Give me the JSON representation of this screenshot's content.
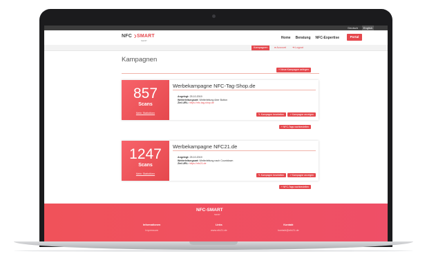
{
  "language": {
    "de": "Deutsch",
    "en": "English"
  },
  "header": {
    "logo_nfc": "NFC",
    "logo_smart": "SMART",
    "logo_sub": "SHOP",
    "nav": [
      "Home",
      "Beratung",
      "NFC-Expertise"
    ],
    "portal_label": "Portal"
  },
  "subnav": {
    "active": "Kampagnen",
    "account": "Account",
    "logout": "Logout"
  },
  "page": {
    "title": "Kampagnen",
    "new_campaign": "+ Neue Kampagne anlegen"
  },
  "campaigns": [
    {
      "scans": "857",
      "scans_label": "Scans",
      "stats_link": "Mehr Statistiken",
      "title": "Werbekampagne NFC-Tag-Shop.de",
      "created_label": "Angelegt:",
      "created": "25.10.2019",
      "forward_label": "Weiterleitungsart:",
      "forward": "Weiterleitung über Button",
      "url_label": "Ziel-URL:",
      "url": "https://nfc-tag-shop.de",
      "edit": "Kampagne bearbeiten",
      "show": "Kampagne anzeigen",
      "order": "+ NFC-Tags nachbestellen"
    },
    {
      "scans": "1247",
      "scans_label": "Scans",
      "stats_link": "Mehr Statistiken",
      "title": "Werbekampagne NFC21.de",
      "created_label": "Angelegt:",
      "created": "25.10.2019",
      "forward_label": "Weiterleitungsart:",
      "forward": "Weiterleitung nach Countdown",
      "url_label": "Ziel-URL:",
      "url": "https://nfc21.de",
      "edit": "Kampagne bearbeiten",
      "show": "Kampagne anzeigen",
      "order": "+ NFC-Tags nachbestellen"
    }
  ],
  "footer": {
    "logo": "NFC-SMART",
    "logo_sub": "SHOP",
    "columns": [
      {
        "heading": "Informationen",
        "link": "Impressum"
      },
      {
        "heading": "Links",
        "link": "www.nfc21.de"
      },
      {
        "heading": "Kontakt",
        "link": "kontakt@nfc21.de"
      }
    ]
  }
}
